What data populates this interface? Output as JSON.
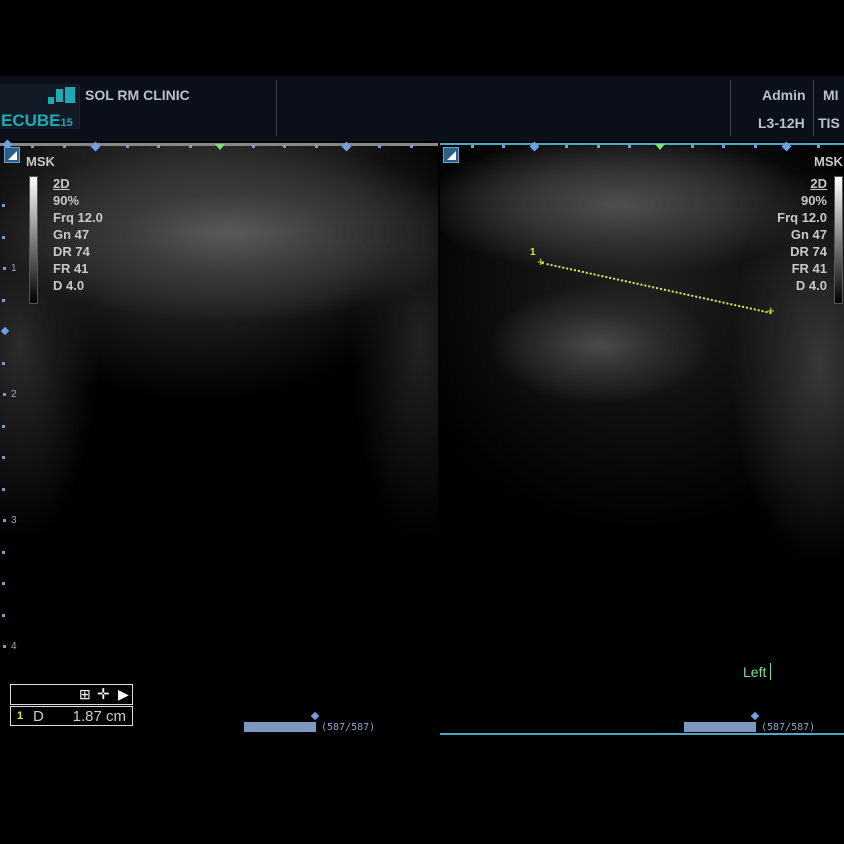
{
  "header": {
    "logo_text": "ECUBE",
    "logo_num": "15",
    "clinic": "SOL RM CLINIC",
    "user": "Admin",
    "mi": "MI",
    "probe": "L3-12H",
    "tis": "TIS"
  },
  "left_panel": {
    "preset": "MSK",
    "mode": "2D",
    "power": "90%",
    "frq": "Frq 12.0",
    "gn": "Gn 47",
    "dr": "DR 74",
    "fr": "FR 41",
    "d": "D 4.0",
    "depth_labels": [
      "1",
      "2",
      "3",
      "4"
    ]
  },
  "right_panel": {
    "preset": "MSK",
    "mode": "2D",
    "power": "90%",
    "frq": "Frq 12.0",
    "gn": "Gn 47",
    "dr": "DR 74",
    "fr": "FR 41",
    "d": "D 4.0",
    "caliper_label": "1",
    "annotation": "Left"
  },
  "measurement": {
    "index": "1",
    "type": "D",
    "value": "1.87 cm"
  },
  "cine": {
    "left": "(587/587)",
    "right": "(587/587)",
    "progress": 1.0
  },
  "colors": {
    "accent": "#1fa9b3",
    "caliper": "#e8e840",
    "annotation": "#7ee07e"
  }
}
